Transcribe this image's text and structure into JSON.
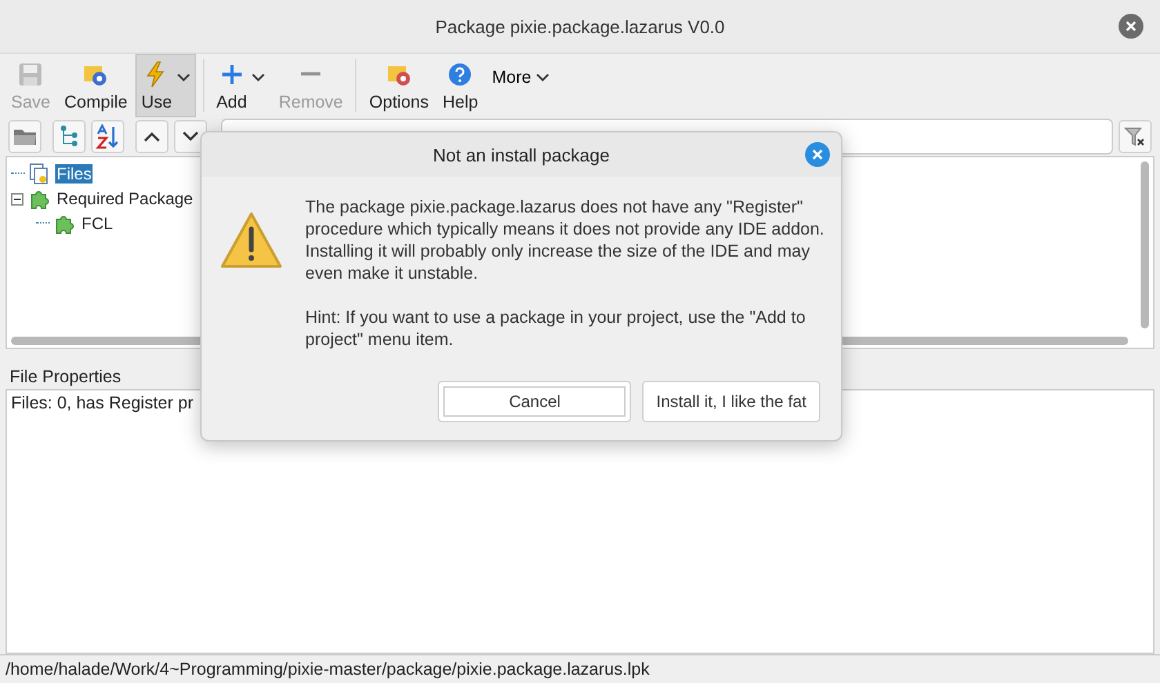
{
  "window": {
    "title": "Package pixie.package.lazarus V0.0"
  },
  "toolbar": [
    {
      "label": "Save",
      "disabled": true,
      "pressed": false,
      "dropdown": false
    },
    {
      "label": "Compile",
      "disabled": false,
      "pressed": false,
      "dropdown": false
    },
    {
      "label": "Use",
      "disabled": false,
      "pressed": true,
      "dropdown": true
    },
    {
      "label": "Add",
      "disabled": false,
      "pressed": false,
      "dropdown": true
    },
    {
      "label": "Remove",
      "disabled": true,
      "pressed": false,
      "dropdown": false
    },
    {
      "label": "Options",
      "disabled": false,
      "pressed": false,
      "dropdown": false
    },
    {
      "label": "Help",
      "disabled": false,
      "pressed": false,
      "dropdown": false
    }
  ],
  "more": {
    "label": "More"
  },
  "tree": [
    {
      "label": "Files",
      "selected": true
    },
    {
      "label": "Required Package",
      "selected": false,
      "expanded": true,
      "children": [
        {
          "label": "FCL",
          "selected": false
        }
      ]
    }
  ],
  "properties": {
    "title": "File Properties",
    "text": "Files: 0, has Register pr"
  },
  "status_bar": "/home/halade/Work/4~Programming/pixie-master/package/pixie.package.lazarus.lpk",
  "dialog": {
    "title": "Not an install package",
    "message": "The package pixie.package.lazarus does not have any \"Register\" procedure which typically means it does not provide any IDE addon. Installing it will probably only increase the size of the IDE and may even make it unstable.",
    "hint": "Hint: If you want to use a package in your project, use the \"Add to project\" menu item.",
    "buttons": [
      {
        "label": "Cancel",
        "selected": true
      },
      {
        "label": "Install it, I like the fat",
        "selected": false
      }
    ]
  }
}
